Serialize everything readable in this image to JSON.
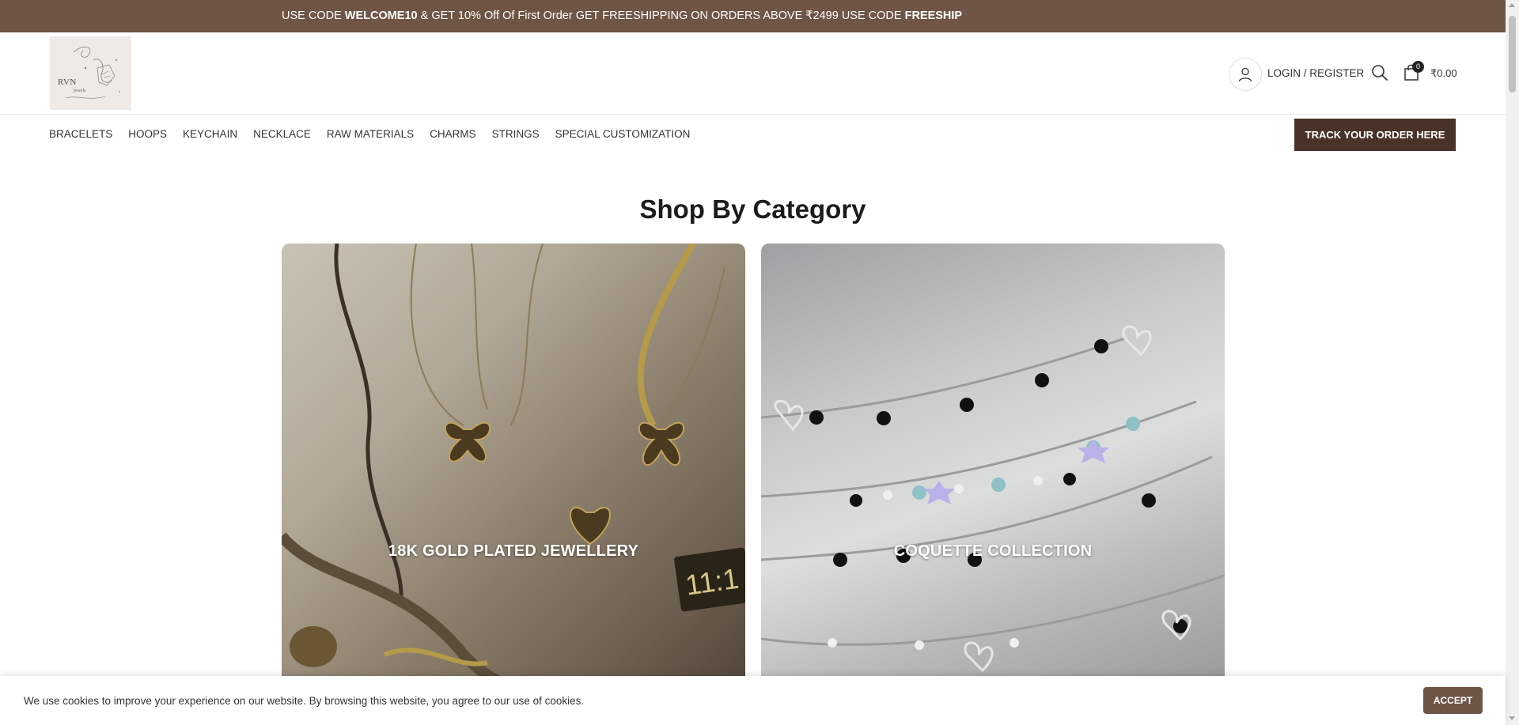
{
  "promo": {
    "part1": "USE CODE ",
    "code1": "WELCOME10",
    "part2": " & GET 10% Off Of First Order GET FREESHIPPING ON ORDERS ABOVE ₹2499 USE CODE ",
    "code2": "FREESHIP"
  },
  "brand": {
    "logo_text": "RVN",
    "logo_sub": "jewels"
  },
  "header": {
    "login_label": "LOGIN / REGISTER",
    "cart_count": "0",
    "cart_total": "₹0.00",
    "icons": [
      "user-icon",
      "search-icon",
      "cart-icon"
    ]
  },
  "nav": {
    "items": [
      {
        "label": "BRACELETS"
      },
      {
        "label": "HOOPS"
      },
      {
        "label": "KEYCHAIN"
      },
      {
        "label": "NECKLACE"
      },
      {
        "label": "RAW MATERIALS"
      },
      {
        "label": "CHARMS"
      },
      {
        "label": "STRINGS"
      },
      {
        "label": "SPECIAL CUSTOMIZATION"
      }
    ],
    "track_label": "TRACK YOUR ORDER HERE"
  },
  "main": {
    "section_title": "Shop By Category",
    "categories": [
      {
        "label": "18K GOLD PLATED JEWELLERY"
      },
      {
        "label": "COQUETTE COLLECTION"
      }
    ]
  },
  "cookie": {
    "text": "We use cookies to improve your experience on our website. By browsing this website, you agree to our use of cookies.",
    "accept_label": "ACCEPT"
  },
  "colors": {
    "promo_bg": "#6f5545",
    "track_bg": "#493329",
    "accept_bg": "#6f5545"
  }
}
